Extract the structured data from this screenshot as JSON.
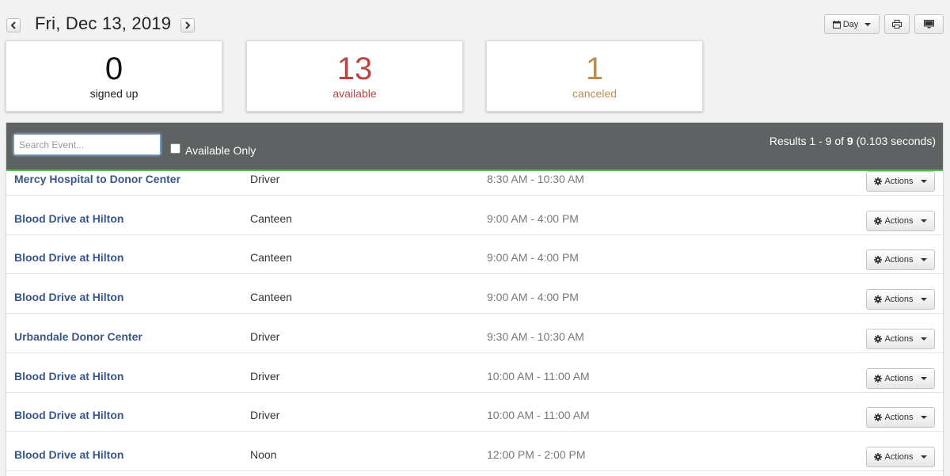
{
  "header": {
    "date": "Fri, Dec 13, 2019",
    "view_label": "Day"
  },
  "stats": {
    "signed_up": {
      "value": "0",
      "label": "signed up",
      "color": "#111111"
    },
    "available": {
      "value": "13",
      "label": "available",
      "color": "#b84545"
    },
    "canceled": {
      "value": "1",
      "label": "canceled",
      "color": "#b6904e"
    }
  },
  "filters": {
    "search_placeholder": "Search Event...",
    "available_only_label": "Available Only",
    "available_only_checked": false
  },
  "results": {
    "prefix": "Results 1 - 9 of ",
    "total": "9",
    "time": " (0.103 seconds)"
  },
  "actions_label": "Actions",
  "events": [
    {
      "name": "Mercy Hospital to Donor Center",
      "role": "Driver",
      "time": "8:30 AM - 10:30 AM"
    },
    {
      "name": "Blood Drive at Hilton",
      "role": "Canteen",
      "time": "9:00 AM - 4:00 PM"
    },
    {
      "name": "Blood Drive at Hilton",
      "role": "Canteen",
      "time": "9:00 AM - 4:00 PM"
    },
    {
      "name": "Blood Drive at Hilton",
      "role": "Canteen",
      "time": "9:00 AM - 4:00 PM"
    },
    {
      "name": "Urbandale Donor Center",
      "role": "Driver",
      "time": "9:30 AM - 10:30 AM"
    },
    {
      "name": "Blood Drive at Hilton",
      "role": "Driver",
      "time": "10:00 AM - 11:00 AM"
    },
    {
      "name": "Blood Drive at Hilton",
      "role": "Driver",
      "time": "10:00 AM - 11:00 AM"
    },
    {
      "name": "Blood Drive at Hilton",
      "role": "Noon",
      "time": "12:00 PM - 2:00 PM"
    }
  ],
  "icons": {
    "prev": "chevron-left-icon",
    "next": "chevron-right-icon",
    "calendar": "calendar-icon",
    "print": "print-icon",
    "monitor": "monitor-icon",
    "gear": "gear-icon"
  }
}
